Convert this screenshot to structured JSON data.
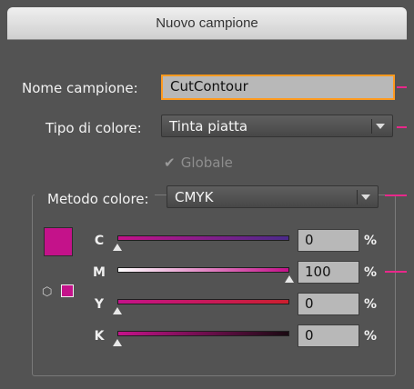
{
  "window": {
    "title": "Nuovo campione"
  },
  "form": {
    "name_label": "Nome campione:",
    "name_value": "CutContour",
    "type_label": "Tipo di colore:",
    "type_value": "Tinta piatta",
    "global_label": "Globale",
    "global_checked": true,
    "mode_label": "Metodo colore:",
    "mode_value": "CMYK"
  },
  "colors": {
    "swatch": "#c4128a",
    "highlight": "#e8288a",
    "focus": "#ff9a1f"
  },
  "sliders": [
    {
      "label": "C",
      "value": "0",
      "unit": "%"
    },
    {
      "label": "M",
      "value": "100",
      "unit": "%"
    },
    {
      "label": "Y",
      "value": "0",
      "unit": "%"
    },
    {
      "label": "K",
      "value": "0",
      "unit": "%"
    }
  ]
}
